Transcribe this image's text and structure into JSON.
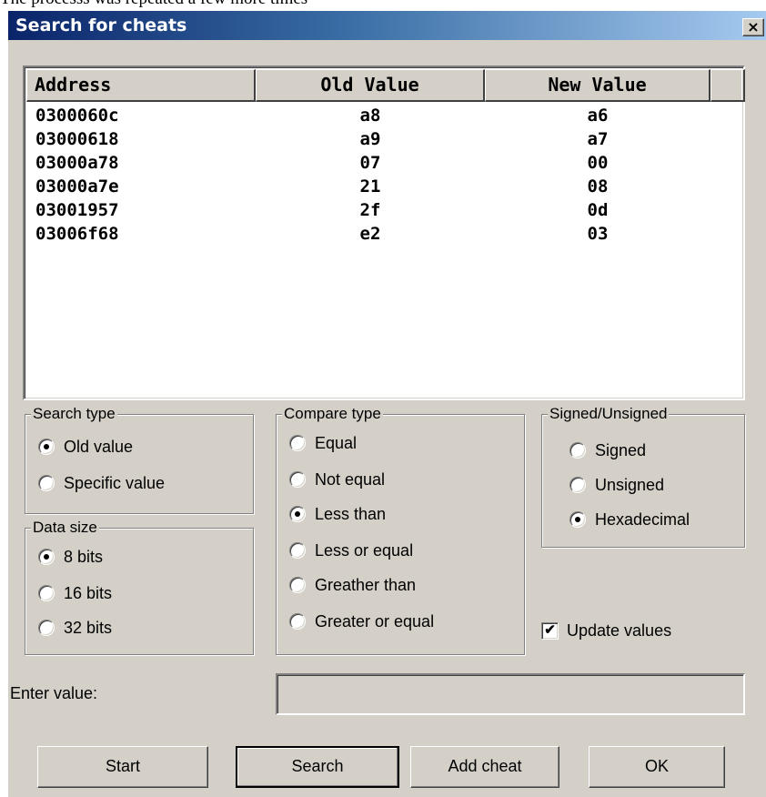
{
  "caption": "The processs was repeated a few more times",
  "window": {
    "title": "Search for cheats",
    "close_glyph": "×"
  },
  "results": {
    "columns": [
      "Address",
      "Old Value",
      "New Value",
      ""
    ],
    "rows": [
      {
        "address": "0300060c",
        "old": "a8",
        "new": "a6"
      },
      {
        "address": "03000618",
        "old": "a9",
        "new": "a7"
      },
      {
        "address": "03000a78",
        "old": "07",
        "new": "00"
      },
      {
        "address": "03000a7e",
        "old": "21",
        "new": "08"
      },
      {
        "address": "03001957",
        "old": "2f",
        "new": "0d"
      },
      {
        "address": "03006f68",
        "old": "e2",
        "new": "03"
      }
    ]
  },
  "search_type": {
    "legend": "Search type",
    "options": [
      {
        "label": "Old value",
        "selected": true
      },
      {
        "label": "Specific value",
        "selected": false
      }
    ]
  },
  "data_size": {
    "legend": "Data size",
    "options": [
      {
        "label": "8 bits",
        "selected": true
      },
      {
        "label": "16 bits",
        "selected": false
      },
      {
        "label": "32 bits",
        "selected": false
      }
    ]
  },
  "compare_type": {
    "legend": "Compare type",
    "options": [
      {
        "label": "Equal",
        "selected": false
      },
      {
        "label": "Not equal",
        "selected": false
      },
      {
        "label": "Less than",
        "selected": true
      },
      {
        "label": "Less or equal",
        "selected": false
      },
      {
        "label": "Greather than",
        "selected": false
      },
      {
        "label": "Greater or equal",
        "selected": false
      }
    ]
  },
  "signedness": {
    "legend": "Signed/Unsigned",
    "options": [
      {
        "label": "Signed",
        "selected": false
      },
      {
        "label": "Unsigned",
        "selected": false
      },
      {
        "label": "Hexadecimal",
        "selected": true
      }
    ]
  },
  "update_values": {
    "label": "Update values",
    "checked": true,
    "check_glyph": "✔"
  },
  "value_entry": {
    "label": "Enter value:",
    "value": ""
  },
  "buttons": {
    "start": "Start",
    "search": "Search",
    "add_cheat": "Add cheat",
    "ok": "OK"
  }
}
